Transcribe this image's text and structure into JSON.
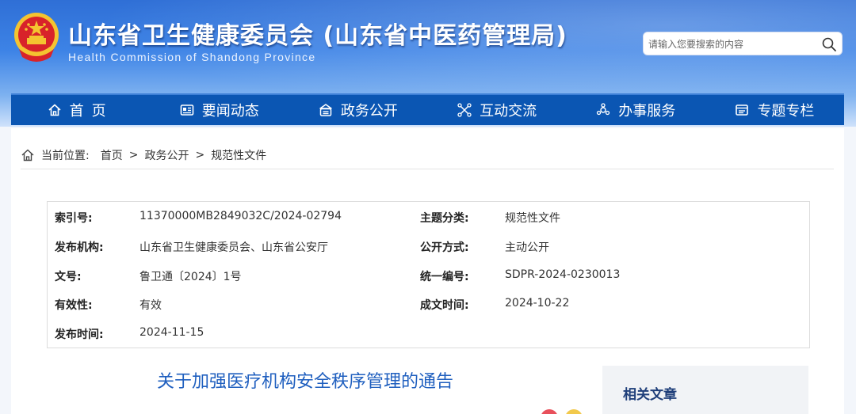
{
  "header": {
    "title": "山东省卫生健康委员会 (山东省中医药管理局)",
    "subtitle": "Health Commission of Shandong Province",
    "search_placeholder": "请输入您要搜索的内容"
  },
  "nav": {
    "items": [
      {
        "label": "首页",
        "icon": "home-icon"
      },
      {
        "label": "要闻动态",
        "icon": "news-icon"
      },
      {
        "label": "政务公开",
        "icon": "gov-open-icon"
      },
      {
        "label": "互动交流",
        "icon": "interaction-icon"
      },
      {
        "label": "办事服务",
        "icon": "service-icon"
      },
      {
        "label": "专题专栏",
        "icon": "topic-icon"
      }
    ]
  },
  "breadcrumb": {
    "label": "当前位置:",
    "items": [
      "首页",
      "政务公开",
      "规范性文件"
    ],
    "separator": ">"
  },
  "meta": {
    "rows": [
      {
        "l1": "索引号:",
        "v1": "11370000MB2849032C/2024-02794",
        "l2": "主题分类:",
        "v2": "规范性文件"
      },
      {
        "l1": "发布机构:",
        "v1": "山东省卫生健康委员会、山东省公安厅",
        "l2": "公开方式:",
        "v2": "主动公开"
      },
      {
        "l1": "文号:",
        "v1": "鲁卫通〔2024〕1号",
        "l2": "统一编号:",
        "v2": "SDPR-2024-0230013"
      },
      {
        "l1": "有效性:",
        "v1": "有效",
        "l2": "成文时间:",
        "v2": "2024-10-22"
      },
      {
        "l1": "发布时间:",
        "v1": "2024-11-15"
      }
    ]
  },
  "document": {
    "title": "关于加强医疗机构安全秩序管理的通告"
  },
  "related": {
    "title": "相关文章"
  },
  "colors": {
    "nav_bg": "#0b56b3",
    "title_blue": "#1f5fbf",
    "emblem_red": "#d8232a",
    "emblem_gold": "#f4c430"
  }
}
